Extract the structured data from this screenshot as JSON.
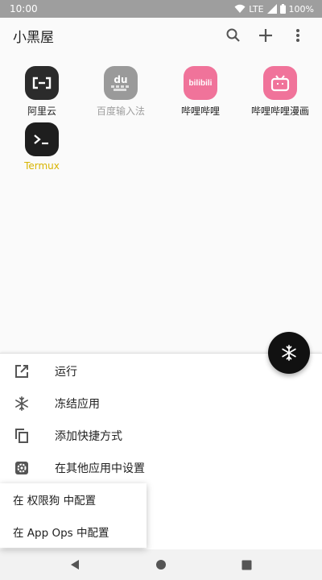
{
  "status_bar": {
    "time": "10:00",
    "network": "LTE",
    "battery": "100%"
  },
  "app_bar": {
    "title": "小黑屋"
  },
  "apps": [
    {
      "label": "阿里云",
      "icon": "aliyun-icon",
      "state": "normal"
    },
    {
      "label": "百度输入法",
      "icon": "baidu-ime-icon",
      "state": "frozen",
      "icon_text": "du"
    },
    {
      "label": "哔哩哔哩",
      "icon": "bilibili-icon",
      "state": "normal",
      "icon_text": "bilibili"
    },
    {
      "label": "哔哩哔哩漫画",
      "icon": "bilibili-comic-icon",
      "state": "normal"
    },
    {
      "label": "Termux",
      "icon": "termux-icon",
      "state": "running"
    }
  ],
  "sheet": {
    "items": [
      {
        "label": "运行",
        "icon": "open-external-icon"
      },
      {
        "label": "冻结应用",
        "icon": "snowflake-icon"
      },
      {
        "label": "添加快捷方式",
        "icon": "copy-icon"
      },
      {
        "label": "在其他应用中设置",
        "icon": "settings-icon"
      }
    ]
  },
  "popup": {
    "items": [
      {
        "label": "在 权限狗 中配置"
      },
      {
        "label": "在 App Ops 中配置"
      }
    ]
  },
  "colors": {
    "status_bar": "#9e9e9e",
    "fab": "#111111",
    "running_label": "#d8b400",
    "bilibili_pink": "#f0739a"
  }
}
